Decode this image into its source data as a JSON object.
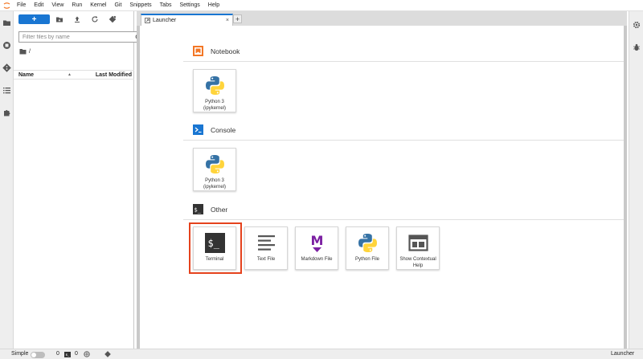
{
  "menu": [
    "File",
    "Edit",
    "View",
    "Run",
    "Kernel",
    "Git",
    "Snippets",
    "Tabs",
    "Settings",
    "Help"
  ],
  "filebrowser": {
    "new_label": "+",
    "filter_placeholder": "Filter files by name",
    "breadcrumb": "/",
    "col_name": "Name",
    "col_modified": "Last Modified"
  },
  "tabs": [
    {
      "label": "Launcher",
      "close": "×"
    }
  ],
  "tab_add": "+",
  "launcher": {
    "sections": [
      {
        "title": "Notebook",
        "cards": [
          {
            "label": "Python 3 (ipykernel)",
            "icon": "python-icon"
          }
        ]
      },
      {
        "title": "Console",
        "cards": [
          {
            "label": "Python 3 (ipykernel)",
            "icon": "python-icon"
          }
        ]
      },
      {
        "title": "Other",
        "cards": [
          {
            "label": "Terminal",
            "icon": "terminal-icon"
          },
          {
            "label": "Text File",
            "icon": "text-file-icon"
          },
          {
            "label": "Markdown File",
            "icon": "markdown-icon"
          },
          {
            "label": "Python File",
            "icon": "python-icon"
          },
          {
            "label": "Show Contextual Help",
            "icon": "contextual-help-icon"
          }
        ]
      }
    ],
    "terminal_icon_text": "$_",
    "markdown_icon_text": "M"
  },
  "status": {
    "mode_label": "Simple",
    "mode_enabled": false,
    "kernels_count": "0",
    "terminals_count": "0",
    "terminal_badge": "$_",
    "right_label": "Launcher"
  },
  "colors": {
    "accent": "#1976d2",
    "highlight": "#e5421d",
    "notebook": "#f37726",
    "console": "#1976d2"
  }
}
